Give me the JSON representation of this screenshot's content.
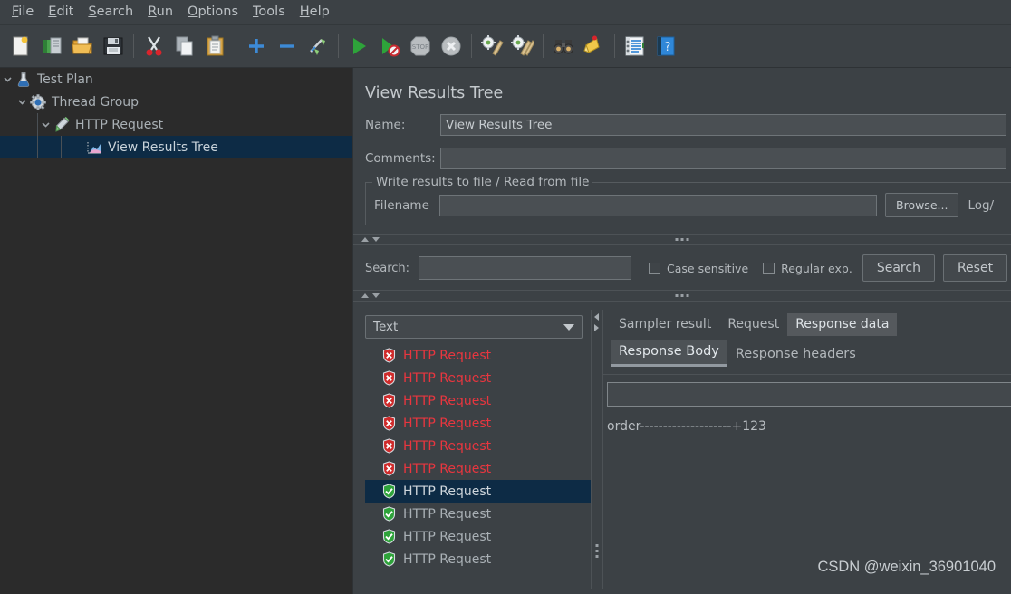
{
  "menubar": {
    "items": [
      {
        "pre": "",
        "mn": "F",
        "post": "ile"
      },
      {
        "pre": "",
        "mn": "E",
        "post": "dit"
      },
      {
        "pre": "",
        "mn": "S",
        "post": "earch"
      },
      {
        "pre": "",
        "mn": "R",
        "post": "un"
      },
      {
        "pre": "",
        "mn": "O",
        "post": "ptions"
      },
      {
        "pre": "",
        "mn": "T",
        "post": "ools"
      },
      {
        "pre": "",
        "mn": "H",
        "post": "elp"
      }
    ]
  },
  "toolbar": {
    "icons": [
      "new-document-icon",
      "open-template-icon",
      "open-folder-icon",
      "save-icon",
      "cut-icon",
      "copy-icon",
      "paste-icon",
      "expand-all-icon",
      "collapse-all-icon",
      "toggle-icon",
      "start-icon",
      "start-no-timers-icon",
      "stop-icon",
      "shutdown-icon",
      "clear-icon",
      "clear-all-icon",
      "search-binoculars-icon",
      "search-reset-icon",
      "function-helper-icon",
      "help-icon"
    ]
  },
  "tree": {
    "nodes": [
      {
        "label": "Test Plan",
        "icon": "test-plan-icon",
        "depth": 0,
        "expanded": true,
        "selected": false
      },
      {
        "label": "Thread Group",
        "icon": "thread-group-icon",
        "depth": 1,
        "expanded": true,
        "selected": false
      },
      {
        "label": "HTTP Request",
        "icon": "http-request-icon",
        "depth": 2,
        "expanded": true,
        "selected": false
      },
      {
        "label": "View Results Tree",
        "icon": "results-tree-icon",
        "depth": 3,
        "expanded": false,
        "selected": true
      }
    ]
  },
  "config": {
    "title": "View Results Tree",
    "name_label": "Name:",
    "name_value": "View Results Tree",
    "comments_label": "Comments:",
    "comments_value": "",
    "group_legend": "Write results to file / Read from file",
    "filename_label": "Filename",
    "filename_value": "",
    "browse_label": "Browse...",
    "log_label": "Log/"
  },
  "search": {
    "label": "Search:",
    "value": "",
    "case_sensitive_label": "Case sensitive",
    "case_sensitive_checked": false,
    "regular_exp_label": "Regular exp.",
    "regular_exp_checked": false,
    "search_button": "Search",
    "reset_button": "Reset"
  },
  "results": {
    "renderer_selected": "Text",
    "items": [
      {
        "label": "HTTP Request",
        "status": "fail",
        "selected": false
      },
      {
        "label": "HTTP Request",
        "status": "fail",
        "selected": false
      },
      {
        "label": "HTTP Request",
        "status": "fail",
        "selected": false
      },
      {
        "label": "HTTP Request",
        "status": "fail",
        "selected": false
      },
      {
        "label": "HTTP Request",
        "status": "fail",
        "selected": false
      },
      {
        "label": "HTTP Request",
        "status": "fail",
        "selected": false
      },
      {
        "label": "HTTP Request",
        "status": "ok",
        "selected": true
      },
      {
        "label": "HTTP Request",
        "status": "ok",
        "selected": false
      },
      {
        "label": "HTTP Request",
        "status": "ok",
        "selected": false
      },
      {
        "label": "HTTP Request",
        "status": "ok",
        "selected": false
      }
    ]
  },
  "detail": {
    "tabs": [
      {
        "label": "Sampler result",
        "active": false
      },
      {
        "label": "Request",
        "active": false
      },
      {
        "label": "Response data",
        "active": true
      }
    ],
    "subtabs": [
      {
        "label": "Response Body",
        "active": true
      },
      {
        "label": "Response headers",
        "active": false
      }
    ],
    "find_value": "",
    "response_body": "order--------------------+123"
  },
  "watermark": "CSDN @weixin_36901040",
  "colors": {
    "background": "#3c4145",
    "tree_background": "#2b2b2b",
    "selection": "#0d2b45",
    "failure_red": "#e8363f",
    "success_green": "#2ea33a",
    "text": "#b3b8bc"
  }
}
